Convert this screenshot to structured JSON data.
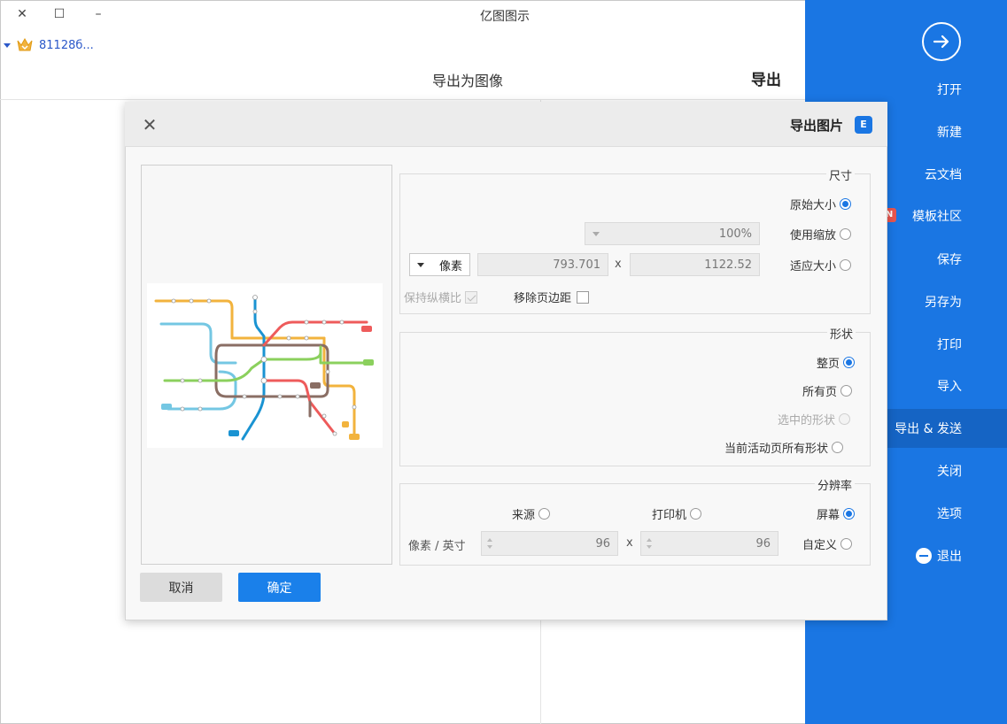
{
  "window": {
    "title": "亿图图示",
    "username": "81128б...",
    "controls": {
      "close": "✕",
      "maximize": "☐",
      "minimize": "–"
    }
  },
  "section": {
    "header": "导出",
    "subheader": "导出为图像"
  },
  "sidebar": {
    "items": [
      {
        "label": "打开"
      },
      {
        "label": "新建"
      },
      {
        "label": "云文档"
      },
      {
        "label": "模板社区",
        "badge": "N"
      },
      {
        "label": "保存"
      },
      {
        "label": "另存为"
      },
      {
        "label": "打印"
      },
      {
        "label": "导入"
      },
      {
        "label": "导出 & 发送",
        "active": true
      },
      {
        "label": "关闭"
      },
      {
        "label": "选项"
      },
      {
        "label": "退出"
      }
    ],
    "colors": {
      "background": "#1a76e3",
      "active": "#1564c4"
    }
  },
  "dialog": {
    "title": "导出图片",
    "icon_letter": "E",
    "close": "✕",
    "size": {
      "title": "尺寸",
      "opt_original": "原始大小",
      "opt_zoom": "使用缩放",
      "zoom_value": "100%",
      "opt_fit": "适应大小",
      "width": "1122.52",
      "height": "793.701",
      "unit": "像素",
      "x": "x",
      "remove_margin": "移除页边距",
      "keep_ratio": "保持纵横比"
    },
    "shape": {
      "title": "形状",
      "opt_full_page": "整页",
      "opt_all_pages": "所有页",
      "opt_selected": "选中的形状",
      "opt_current_all": "当前活动页所有形状"
    },
    "resolution": {
      "title": "分辨率",
      "opt_screen": "屏幕",
      "opt_printer": "打印机",
      "opt_source": "来源",
      "opt_custom": "自定义",
      "dpi_x": "96",
      "dpi_y": "96",
      "unit": "像素 / 英寸",
      "x": "x"
    },
    "ok": "确定",
    "cancel": "取消"
  }
}
